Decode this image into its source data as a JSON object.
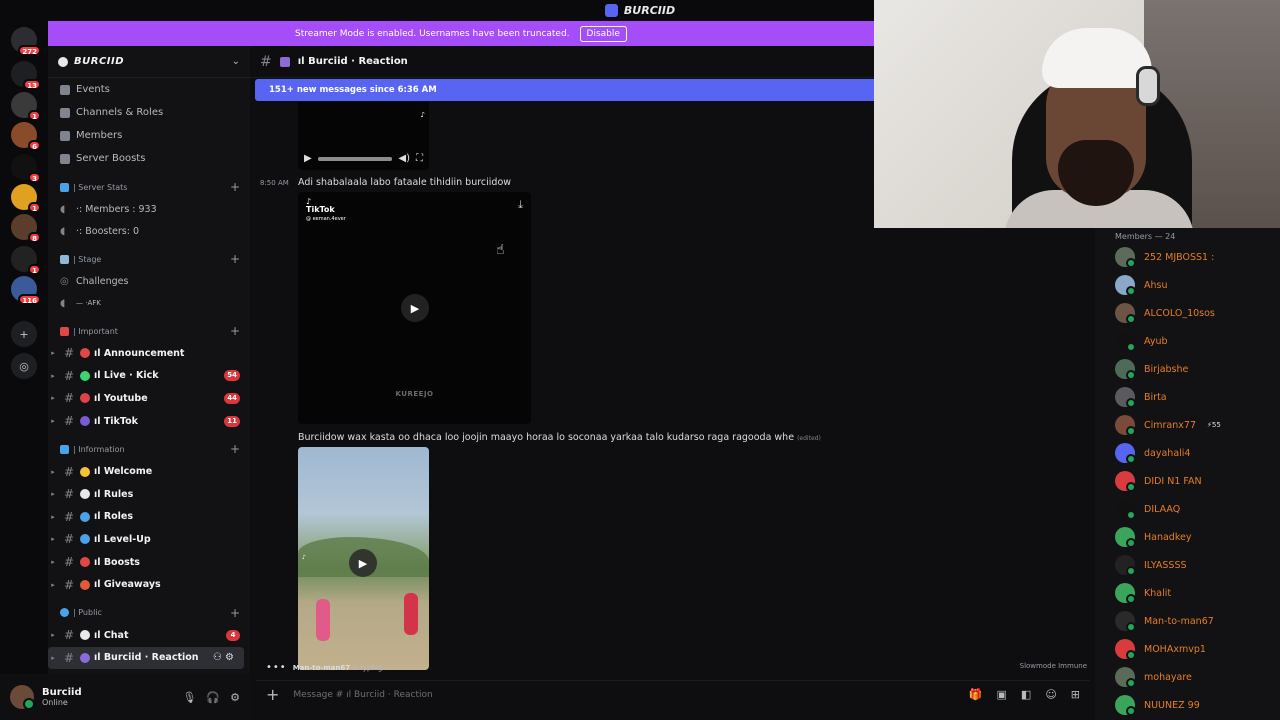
{
  "window": {
    "title": "BURCIID"
  },
  "rail": {
    "items": [
      {
        "badge": "272",
        "color": "#2b2d31"
      },
      {
        "badge": "13",
        "color": "#1e1f22"
      },
      {
        "badge": "1",
        "color": "#3a3a3a"
      },
      {
        "badge": "6",
        "color": "#8a4b2a"
      },
      {
        "badge": "3",
        "color": "#111"
      },
      {
        "badge": "1",
        "color": "#e0a020"
      },
      {
        "badge": "8",
        "color": "#5a3d2a"
      },
      {
        "badge": "1",
        "color": "#222"
      },
      {
        "badge": "116",
        "color": "#3a5a9a"
      }
    ]
  },
  "streamer_banner": {
    "text": "Streamer Mode is enabled. Usernames have been truncated.",
    "button": "Disable"
  },
  "server": {
    "name": "BURCIID"
  },
  "sidebar": {
    "nav": [
      {
        "label": "Events"
      },
      {
        "label": "Channels & Roles"
      },
      {
        "label": "Members"
      },
      {
        "label": "Server Boosts"
      }
    ],
    "cat_stats": "| Server Stats",
    "stats": [
      {
        "label": "·: Members : 933"
      },
      {
        "label": "·: Boosters: 0"
      }
    ],
    "cat_stage": "| Stage",
    "stage": [
      {
        "label": "Challenges"
      },
      {
        "label": "— ·AFK"
      }
    ],
    "cat_important": "| Important",
    "important": [
      {
        "label": "ıl Announcement",
        "badge": "",
        "color": "#e04848"
      },
      {
        "label": "ıl Live · Kick",
        "badge": "54",
        "color": "#3bd671"
      },
      {
        "label": "ıl Youtube",
        "badge": "44",
        "color": "#e0424a"
      },
      {
        "label": "ıl TikTok",
        "badge": "11",
        "color": "#7b5ad6"
      }
    ],
    "cat_information": "| Information",
    "information": [
      {
        "label": "ıl Welcome",
        "color": "#f5c23a"
      },
      {
        "label": "ıl Rules",
        "color": "#e8e8e8"
      },
      {
        "label": "ıl Roles",
        "color": "#4aa3e8"
      },
      {
        "label": "ıl Level-Up",
        "color": "#4aa3e8"
      },
      {
        "label": "ıl Boosts",
        "color": "#e04848"
      },
      {
        "label": "ıl Giveaways",
        "color": "#e05a3a"
      }
    ],
    "cat_public": "| Public",
    "public": [
      {
        "label": "ıl Chat",
        "badge": "4",
        "color": "#e8e8e8"
      },
      {
        "label": "ıl Burciid · Reaction",
        "badge": "",
        "color": "#8c6bd9"
      }
    ]
  },
  "user": {
    "name": "Burciid",
    "status": "Online"
  },
  "chat": {
    "channel_name": "ıl Burciid · Reaction",
    "new_messages": "151+ new messages since 6:36 AM",
    "messages": [
      {
        "time": "8:50 AM",
        "text": "Adi shabalaala labo fataale tihidiin burciidow",
        "edited": ""
      },
      {
        "time": "",
        "text": "Burciidow wax kasta oo dhaca loo joojin maayo horaa lo soconaa yarkaa talo kudarso raga ragooda whe",
        "edited": "(edited)"
      }
    ],
    "video_tiktok_label": "TikTok",
    "video_tiktok_handle": "@ eeman.4ever",
    "video_watermark": "KUREEJO",
    "typing_user": "Man-to-man67",
    "typing_suffix": "is typing...",
    "slowmode": "Slowmode Immune",
    "composer_placeholder": "Message # ıl Burciid · Reaction"
  },
  "members": {
    "header": "Members — 24",
    "list": [
      {
        "name": "252 MJBOSS1 :",
        "color": "#e67e22",
        "avatar": "#5c6b5a",
        "extra": ""
      },
      {
        "name": "Ahsu",
        "color": "#e67e22",
        "avatar": "#8aa8c9",
        "extra": ""
      },
      {
        "name": "ALCOLO_10sos",
        "color": "#e67e22",
        "avatar": "#6b5544",
        "extra": ""
      },
      {
        "name": "Ayub",
        "color": "#e67e22",
        "avatar": "#111",
        "extra": ""
      },
      {
        "name": "Birjabshe",
        "color": "#e67e22",
        "avatar": "#4e6a5a",
        "extra": ""
      },
      {
        "name": "Birta",
        "color": "#e67e22",
        "avatar": "#5a5a60",
        "extra": ""
      },
      {
        "name": "Cimranx77",
        "color": "#e67e22",
        "avatar": "#7a4a3a",
        "extra": "⚡55"
      },
      {
        "name": "dayahali4",
        "color": "#e67e22",
        "avatar": "#5865f2",
        "extra": ""
      },
      {
        "name": "DIDI N1 FAN",
        "color": "#e67e22",
        "avatar": "#d83c3e",
        "extra": ""
      },
      {
        "name": "DILAAQ",
        "color": "#e67e22",
        "avatar": "#111",
        "extra": ""
      },
      {
        "name": "Hanadkey",
        "color": "#e67e22",
        "avatar": "#3ba55c",
        "extra": ""
      },
      {
        "name": "ILYASSSS",
        "color": "#e67e22",
        "avatar": "#222",
        "extra": ""
      },
      {
        "name": "Khalit",
        "color": "#e67e22",
        "avatar": "#3ba55c",
        "extra": ""
      },
      {
        "name": "Man-to-man67",
        "color": "#e67e22",
        "avatar": "#2a2a2a",
        "extra": ""
      },
      {
        "name": "MOHAxmvp1",
        "color": "#e67e22",
        "avatar": "#d83c3e",
        "extra": ""
      },
      {
        "name": "mohayare",
        "color": "#e67e22",
        "avatar": "#5b6b5a",
        "extra": ""
      },
      {
        "name": "NUUNEZ 99",
        "color": "#e67e22",
        "avatar": "#3ba55c",
        "extra": ""
      }
    ]
  }
}
